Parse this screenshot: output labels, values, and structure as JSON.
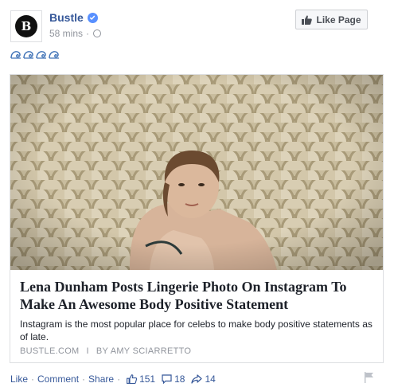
{
  "header": {
    "page_name": "Bustle",
    "avatar_letter": "B",
    "timestamp": "58 mins",
    "like_page_label": "Like Page"
  },
  "post": {
    "emoji_count": 4
  },
  "link": {
    "title": "Lena Dunham Posts Lingerie Photo On Instagram To Make An Awesome Body Positive Statement",
    "description": "Instagram is the most popular place for celebs to make body positive statements as of late.",
    "source": "BUSTLE.COM",
    "divider": "I",
    "byline": "BY AMY SCIARRETTO"
  },
  "actions": {
    "like": "Like",
    "comment": "Comment",
    "share": "Share",
    "separator": "·",
    "likes_count": "151",
    "comments_count": "18",
    "shares_count": "14"
  },
  "colors": {
    "link_blue": "#365899",
    "meta_gray": "#90949c",
    "verified_blue": "#5890ff"
  }
}
